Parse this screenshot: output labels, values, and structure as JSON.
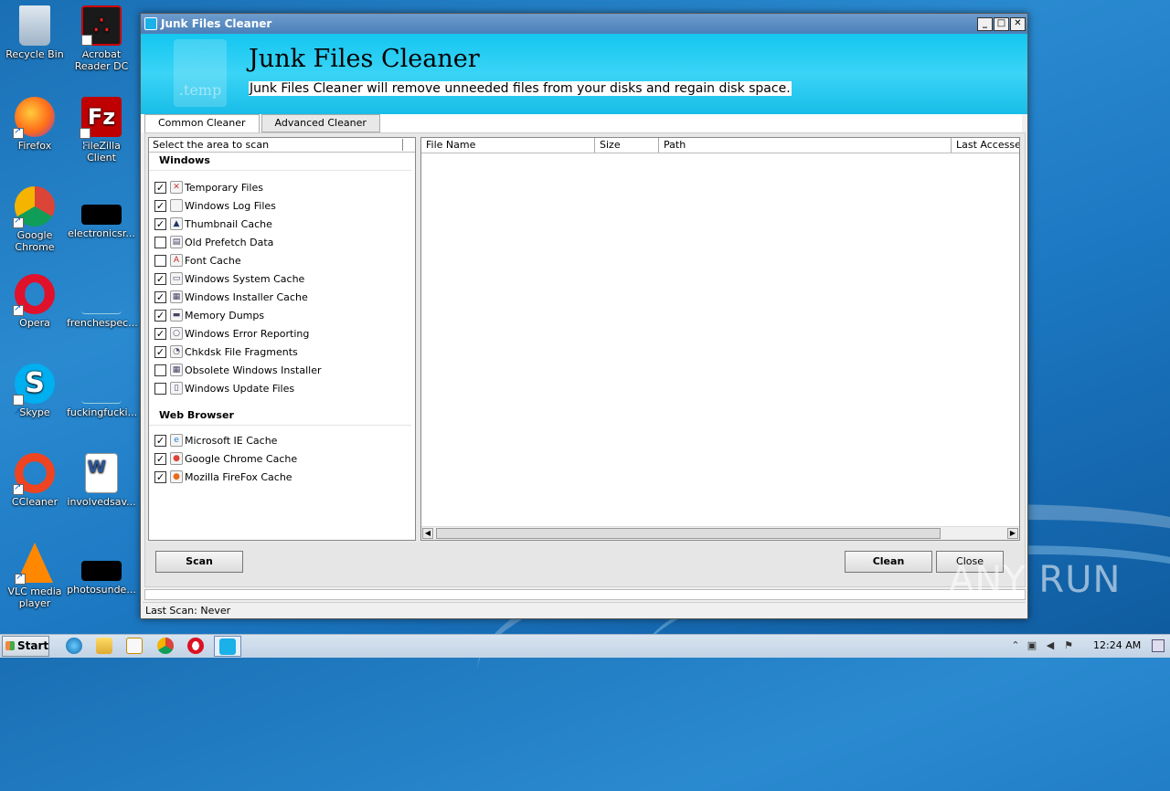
{
  "desktop": {
    "icons": [
      {
        "label": "Recycle Bin"
      },
      {
        "label": "Acrobat Reader DC"
      },
      {
        "label": "Firefox"
      },
      {
        "label": "FileZilla Client"
      },
      {
        "label": "Google Chrome"
      },
      {
        "label": "electronicsr..."
      },
      {
        "label": "Opera"
      },
      {
        "label": "frenchespec..."
      },
      {
        "label": "Skype"
      },
      {
        "label": "fuckingfucki..."
      },
      {
        "label": "CCleaner"
      },
      {
        "label": "involvedsav..."
      },
      {
        "label": "VLC media player"
      },
      {
        "label": "photosunde..."
      }
    ]
  },
  "window": {
    "title": "Junk Files Cleaner",
    "banner_title": "Junk Files Cleaner",
    "banner_subtitle": "Junk Files Cleaner will remove unneeded files from your disks and regain disk space.",
    "banner_icon_text": ".temp",
    "tabs": [
      {
        "label": "Common Cleaner",
        "active": true
      },
      {
        "label": "Advanced Cleaner",
        "active": false
      }
    ],
    "left_panel": {
      "header": "Select the area to scan",
      "groups": [
        {
          "title": "Windows",
          "items": [
            {
              "label": "Temporary Files",
              "checked": true,
              "icon": "temp-files-icon"
            },
            {
              "label": "Windows Log Files",
              "checked": true,
              "icon": "log-file-icon"
            },
            {
              "label": "Thumbnail Cache",
              "checked": true,
              "icon": "thumbnail-icon"
            },
            {
              "label": "Old Prefetch Data",
              "checked": false,
              "icon": "prefetch-icon"
            },
            {
              "label": "Font Cache",
              "checked": false,
              "icon": "font-icon"
            },
            {
              "label": "Windows System Cache",
              "checked": true,
              "icon": "system-cache-icon"
            },
            {
              "label": "Windows Installer Cache",
              "checked": true,
              "icon": "installer-icon"
            },
            {
              "label": "Memory Dumps",
              "checked": true,
              "icon": "memory-icon"
            },
            {
              "label": "Windows Error Reporting",
              "checked": true,
              "icon": "error-report-icon"
            },
            {
              "label": "Chkdsk File Fragments",
              "checked": true,
              "icon": "chkdsk-icon"
            },
            {
              "label": "Obsolete Windows Installer",
              "checked": false,
              "icon": "installer-icon"
            },
            {
              "label": "Windows Update Files",
              "checked": false,
              "icon": "update-icon"
            }
          ]
        },
        {
          "title": "Web Browser",
          "items": [
            {
              "label": "Microsoft IE Cache",
              "checked": true,
              "icon": "ie-icon"
            },
            {
              "label": "Google Chrome Cache",
              "checked": true,
              "icon": "chrome-icon"
            },
            {
              "label": "Mozilla FireFox Cache",
              "checked": true,
              "icon": "firefox-icon"
            }
          ]
        }
      ]
    },
    "table": {
      "columns": [
        "File Name",
        "Size",
        "Path",
        "Last Accessed"
      ]
    },
    "buttons": {
      "scan": "Scan",
      "clean": "Clean",
      "close": "Close"
    },
    "status": "Last Scan: Never"
  },
  "taskbar": {
    "start_label": "Start",
    "clock": "12:24 AM"
  },
  "watermark": "ANY RUN",
  "colors": {
    "banner": "#14c6f0",
    "titlebar": "#4a7fb8",
    "desktop": "#1a6fb4"
  }
}
